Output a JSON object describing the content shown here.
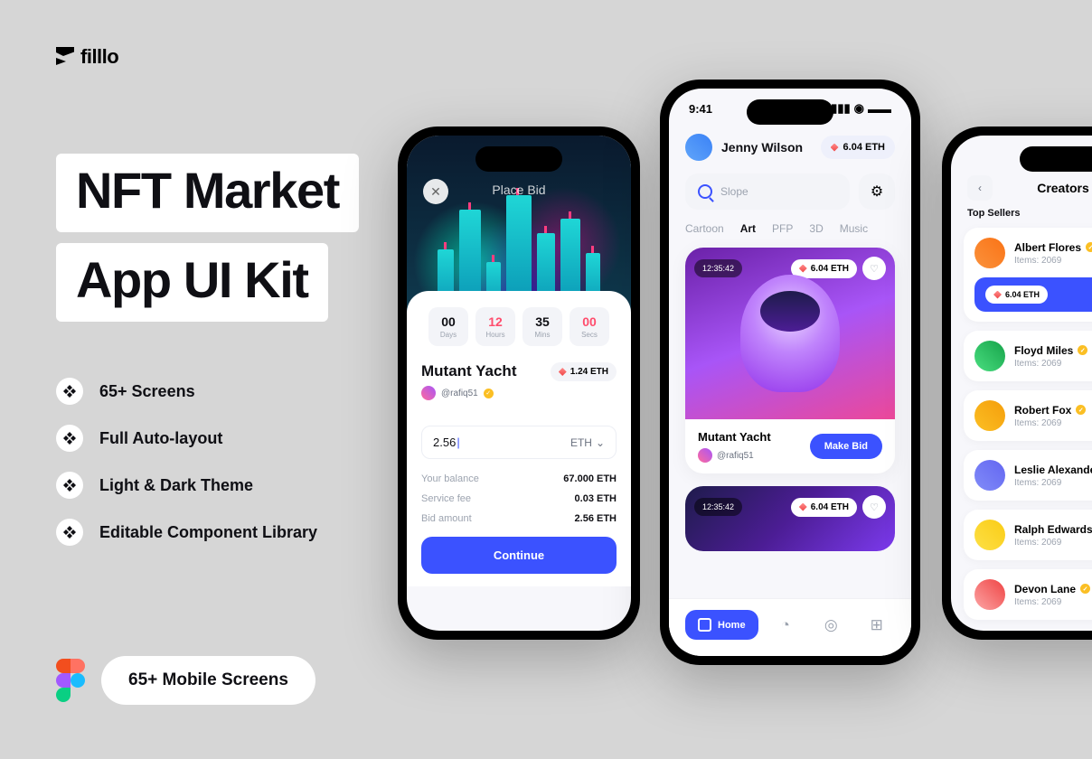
{
  "brand": {
    "name": "filllo"
  },
  "hero": {
    "line1": "NFT Market",
    "line2": "App UI Kit"
  },
  "features": [
    {
      "text": "65+ Screens"
    },
    {
      "text": "Full Auto-layout"
    },
    {
      "text": "Light & Dark Theme"
    },
    {
      "text": "Editable Component Library"
    }
  ],
  "figma_pill": "65+ Mobile Screens",
  "status": {
    "time": "9:41"
  },
  "phone1": {
    "screen_title": "Place Bid",
    "countdown": {
      "days": "00",
      "hours": "12",
      "mins": "35",
      "secs": "00",
      "days_l": "Days",
      "hours_l": "Hours",
      "mins_l": "Mins",
      "secs_l": "Secs"
    },
    "nft_title": "Mutant Yacht",
    "creator": "@rafiq51",
    "price": "1.24 ETH",
    "bid_input": "2.56",
    "bid_currency": "ETH",
    "fees": [
      {
        "label": "Your balance",
        "value": "67.000 ETH"
      },
      {
        "label": "Service fee",
        "value": "0.03 ETH"
      },
      {
        "label": "Bid amount",
        "value": "2.56 ETH"
      }
    ],
    "cta": "Continue"
  },
  "phone2": {
    "user_name": "Jenny Wilson",
    "balance": "6.04 ETH",
    "search_value": "Slope",
    "tabs": [
      "Cartoon",
      "Art",
      "PFP",
      "3D",
      "Music"
    ],
    "active_tab": "Art",
    "card1": {
      "timer": "12:35:42",
      "price": "6.04 ETH",
      "title": "Mutant Yacht",
      "creator": "@rafiq51",
      "cta": "Make Bid"
    },
    "card2": {
      "timer": "12:35:42",
      "price": "6.04 ETH"
    },
    "nav_home": "Home"
  },
  "phone3": {
    "title": "Creators",
    "section": "Top Sellers",
    "sellers": [
      {
        "name": "Albert Flores",
        "items_label": "Items:",
        "items": "2069",
        "eth": "6.04 ETH"
      },
      {
        "name": "Floyd Miles",
        "items_label": "Items:",
        "items": "2069"
      },
      {
        "name": "Robert Fox",
        "items_label": "Items:",
        "items": "2069"
      },
      {
        "name": "Leslie Alexander",
        "items_label": "Items:",
        "items": "2069"
      },
      {
        "name": "Ralph Edwards",
        "items_label": "Items:",
        "items": "2069"
      },
      {
        "name": "Devon Lane",
        "items_label": "Items:",
        "items": "2069"
      }
    ]
  }
}
